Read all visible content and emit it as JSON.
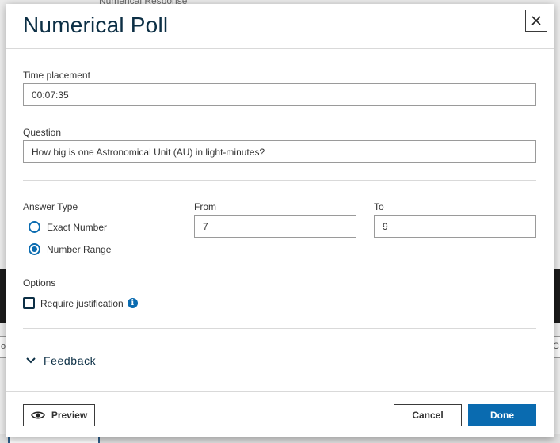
{
  "background": {
    "top_text": "Numerical Response",
    "left_chip": "o",
    "right_chip": "C"
  },
  "modal": {
    "title": "Numerical Poll",
    "time_placement": {
      "label": "Time placement",
      "value": "00:07:35"
    },
    "question": {
      "label": "Question",
      "value": "How big is one Astronomical Unit (AU) in light-minutes?"
    },
    "answer_type": {
      "label": "Answer Type",
      "options": [
        {
          "label": "Exact Number",
          "selected": false
        },
        {
          "label": "Number Range",
          "selected": true
        }
      ]
    },
    "range": {
      "from_label": "From",
      "from_value": "7",
      "to_label": "To",
      "to_value": "9"
    },
    "options": {
      "label": "Options",
      "require_justification": "Require justification",
      "require_justification_checked": false
    },
    "feedback": {
      "label": "Feedback"
    },
    "footer": {
      "preview": "Preview",
      "cancel": "Cancel",
      "done": "Done"
    }
  },
  "colors": {
    "accent": "#0a6bb0",
    "title": "#0c2f45",
    "border": "#9a9a9a"
  },
  "icons": {
    "close": "close-icon",
    "info": "info-icon",
    "chevron": "chevron-down-icon",
    "eye": "eye-icon"
  }
}
